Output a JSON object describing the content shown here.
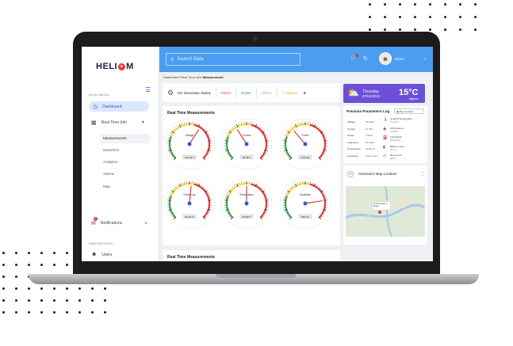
{
  "brand": {
    "logo_pre": "HELI",
    "logo_o": "+",
    "logo_post": "M"
  },
  "sidebar": {
    "main_menu_label": "MAIN MENU",
    "dashboard": "Dashboard",
    "real_time_info": "Real Time Info",
    "sub_items": [
      "Measurements",
      "Waveform",
      "Analytics",
      "Alarms",
      "Map"
    ],
    "notifications": "Notifications",
    "notifications_count": "1",
    "preferences_label": "PREFERENCES",
    "users": "Users"
  },
  "topbar": {
    "search_placeholder": "Search Data",
    "admin": "Admin"
  },
  "breadcrumb": {
    "trail": "Dashboard/ Real Time Info/ ",
    "current": "Measurement"
  },
  "status": {
    "title": "KH Generator Status",
    "fuel": "Petrol",
    "online": "Online",
    "offline": "Offline",
    "alarms_label": "Alarms",
    "alarms_count": "3"
  },
  "weather": {
    "day": "Thursday",
    "date": "07/01/2021",
    "temp": "15°C",
    "location": "Nigeria"
  },
  "gauges_panel": {
    "title": "Real Time Measurements",
    "gauges": [
      {
        "label": "Voltage",
        "readout": "123.26 V",
        "level": 0.62
      },
      {
        "label": "Current",
        "readout": "25.08 A",
        "level": 0.38
      },
      {
        "label": "Power",
        "readout": "1.60 kW",
        "level": 0.35
      },
      {
        "label": "Frequency",
        "readout": "50.26 Hz",
        "level": 0.52
      },
      {
        "label": "Temperature",
        "readout": "35.62°C",
        "level": 0.5
      },
      {
        "label": "Amplitude",
        "readout": "600 mA",
        "level": 0.8
      }
    ]
  },
  "second_panel": {
    "title": "Real Time Measurements"
  },
  "log": {
    "title": "Previous Parameters Log",
    "date": "May 04 2021",
    "rows": [
      {
        "k": "Voltage",
        "v": "220.00V"
      },
      {
        "k": "Current",
        "v": "21.05A"
      },
      {
        "k": "Power",
        "v": "3.5KW"
      },
      {
        "k": "Frequency",
        "v": "50.00Hz"
      },
      {
        "k": "Temperature",
        "v": "20.56 oC"
      },
      {
        "k": "Amplitude",
        "v": "0.00 meters"
      }
    ],
    "right": [
      {
        "t": "Coolant Temperature",
        "s": "77.0 oC"
      },
      {
        "t": "Oil Pressure",
        "s": "4.5 Bar"
      },
      {
        "t": "Fuel Depth",
        "s": "20.0 litres"
      },
      {
        "t": "Battery Level",
        "s": "27.6 V"
      },
      {
        "t": "Run Hours",
        "s": "800 h"
      }
    ]
  },
  "map": {
    "title": "Generator Map Location",
    "tip_line1": "KH Generator 1",
    "tip_line2": "Abuja"
  },
  "colors": {
    "primary": "#4b9df0",
    "weather": "#6b4fd8",
    "danger": "#e53935",
    "success": "#2e9e44",
    "warning": "#f4a300"
  }
}
